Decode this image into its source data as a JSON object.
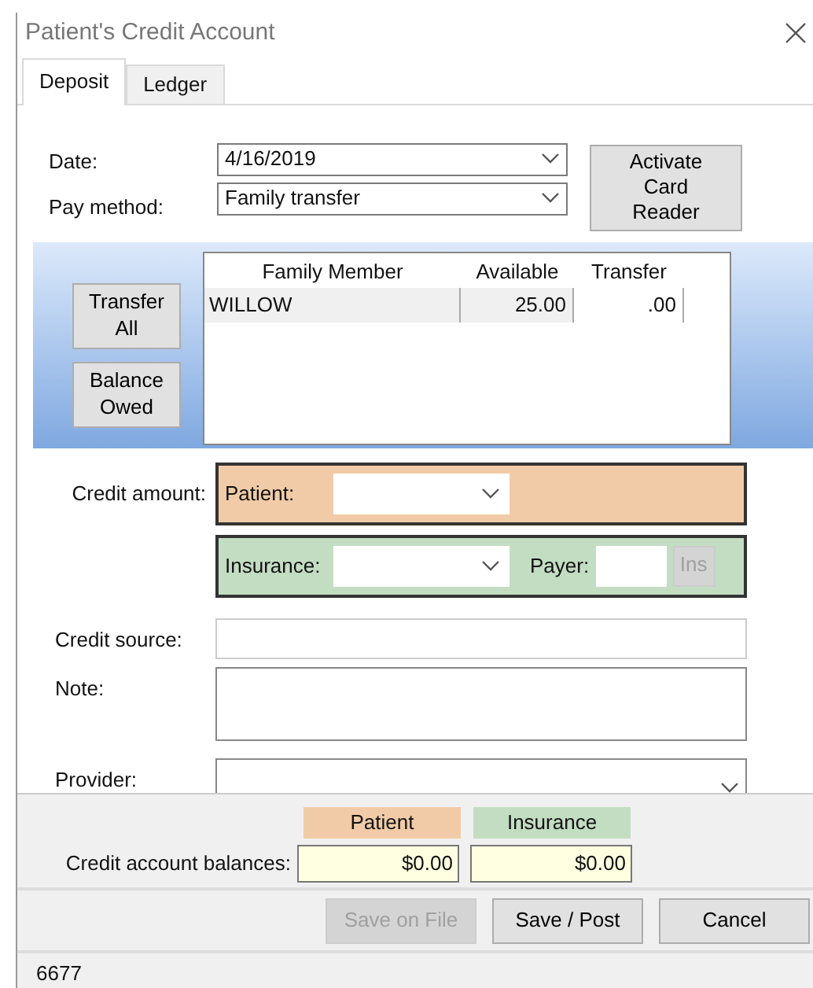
{
  "window": {
    "title": "Patient's Credit Account"
  },
  "tabs": [
    {
      "label": "Deposit",
      "selected": true
    },
    {
      "label": "Ledger",
      "selected": false
    }
  ],
  "form": {
    "date_label": "Date:",
    "date_value": "4/16/2019",
    "pay_method_label": "Pay method:",
    "pay_method_value": "Family transfer",
    "card_reader_button": "Activate Card Reader"
  },
  "transfer": {
    "buttons": [
      "Transfer All",
      "Balance Owed"
    ],
    "columns": [
      "Family Member",
      "Available",
      "Transfer"
    ],
    "rows": [
      {
        "member": "WILLOW",
        "available": "25.00",
        "transfer": ".00"
      }
    ]
  },
  "credit_amount": {
    "label": "Credit amount:",
    "patient_label": "Patient:",
    "insurance_label": "Insurance:",
    "payer_label": "Payer:",
    "ins_button": {
      "label": "Ins",
      "disabled": true
    }
  },
  "credit_source_label": "Credit source:",
  "note_label": "Note:",
  "provider_label": "Provider:",
  "balances": {
    "label": "Credit account balances:",
    "patient_header": "Patient",
    "insurance_header": "Insurance",
    "patient_value": "$0.00",
    "insurance_value": "$0.00"
  },
  "buttons": [
    {
      "label": "Save on File",
      "disabled": true
    },
    {
      "label": "Save / Post",
      "disabled": false
    },
    {
      "label": "Cancel",
      "disabled": false
    }
  ],
  "status_bar": "6677"
}
